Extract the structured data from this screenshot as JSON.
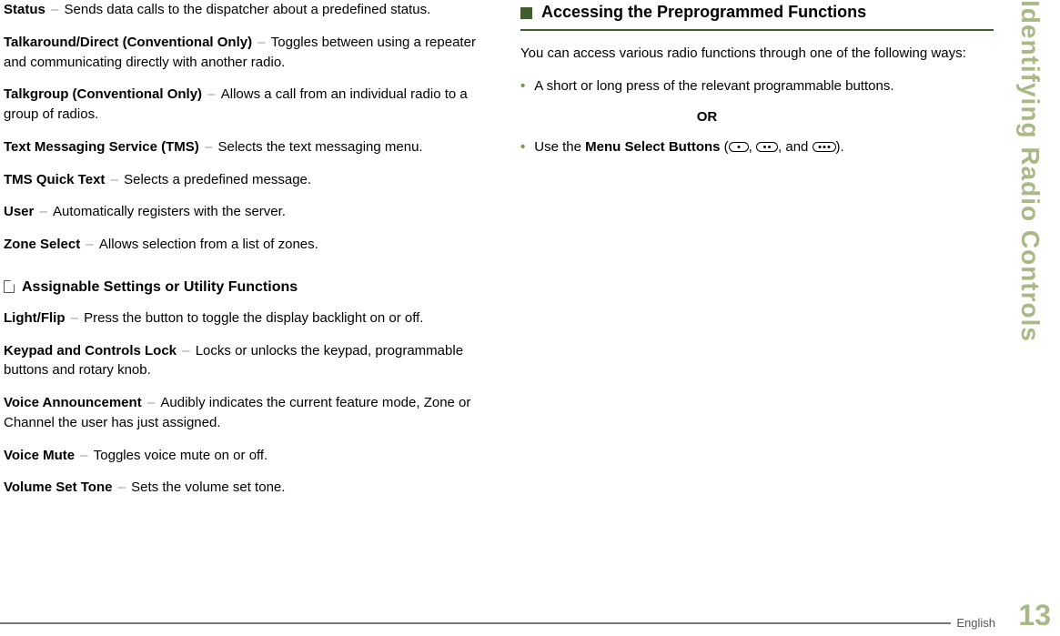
{
  "sidebarTitle": "Identifying Radio Controls",
  "pageNumber": "13",
  "footerLang": "English",
  "left": {
    "defs1": [
      {
        "term": "Status",
        "desc": "Sends data calls to the dispatcher about a predefined status."
      },
      {
        "term": "Talkaround/Direct (Conventional Only)",
        "desc": "Toggles between using a repeater and communicating directly with another radio."
      },
      {
        "term": "Talkgroup (Conventional Only)",
        "desc": "Allows a call from an individual radio to a group of radios."
      },
      {
        "term": "Text Messaging Service (TMS)",
        "desc": "Selects the text messaging menu."
      },
      {
        "term": "TMS Quick Text",
        "desc": "Selects a predefined message."
      },
      {
        "term": "User",
        "desc": "Automatically registers with the server."
      },
      {
        "term": "Zone Select",
        "desc": "Allows selection from a list of zones."
      }
    ],
    "subheading": "Assignable Settings or Utility Functions",
    "defs2": [
      {
        "term": "Light/Flip",
        "desc": "Press the button to toggle the display backlight on or off."
      },
      {
        "term": "Keypad and Controls Lock",
        "desc": "Locks or unlocks the keypad, programmable buttons and rotary knob."
      },
      {
        "term": "Voice Announcement",
        "desc": "Audibly indicates the current feature mode, Zone or Channel the user has just assigned."
      },
      {
        "term": "Voice Mute",
        "desc": "Toggles voice mute on or off."
      },
      {
        "term": "Volume Set Tone",
        "desc": "Sets the volume set tone."
      }
    ]
  },
  "right": {
    "heading": "Accessing the Preprogrammed Functions",
    "intro": "You can access various radio functions through one of the following ways:",
    "bullet1": "A short or long press of the relevant programmable buttons.",
    "orLabel": "OR",
    "bullet2_prefix": "Use the ",
    "bullet2_bold": "Menu Select Buttons",
    "bullet2_open": " (",
    "bullet2_sep1": ", ",
    "bullet2_sep2": ", and ",
    "bullet2_close": ")."
  },
  "dash": " – "
}
